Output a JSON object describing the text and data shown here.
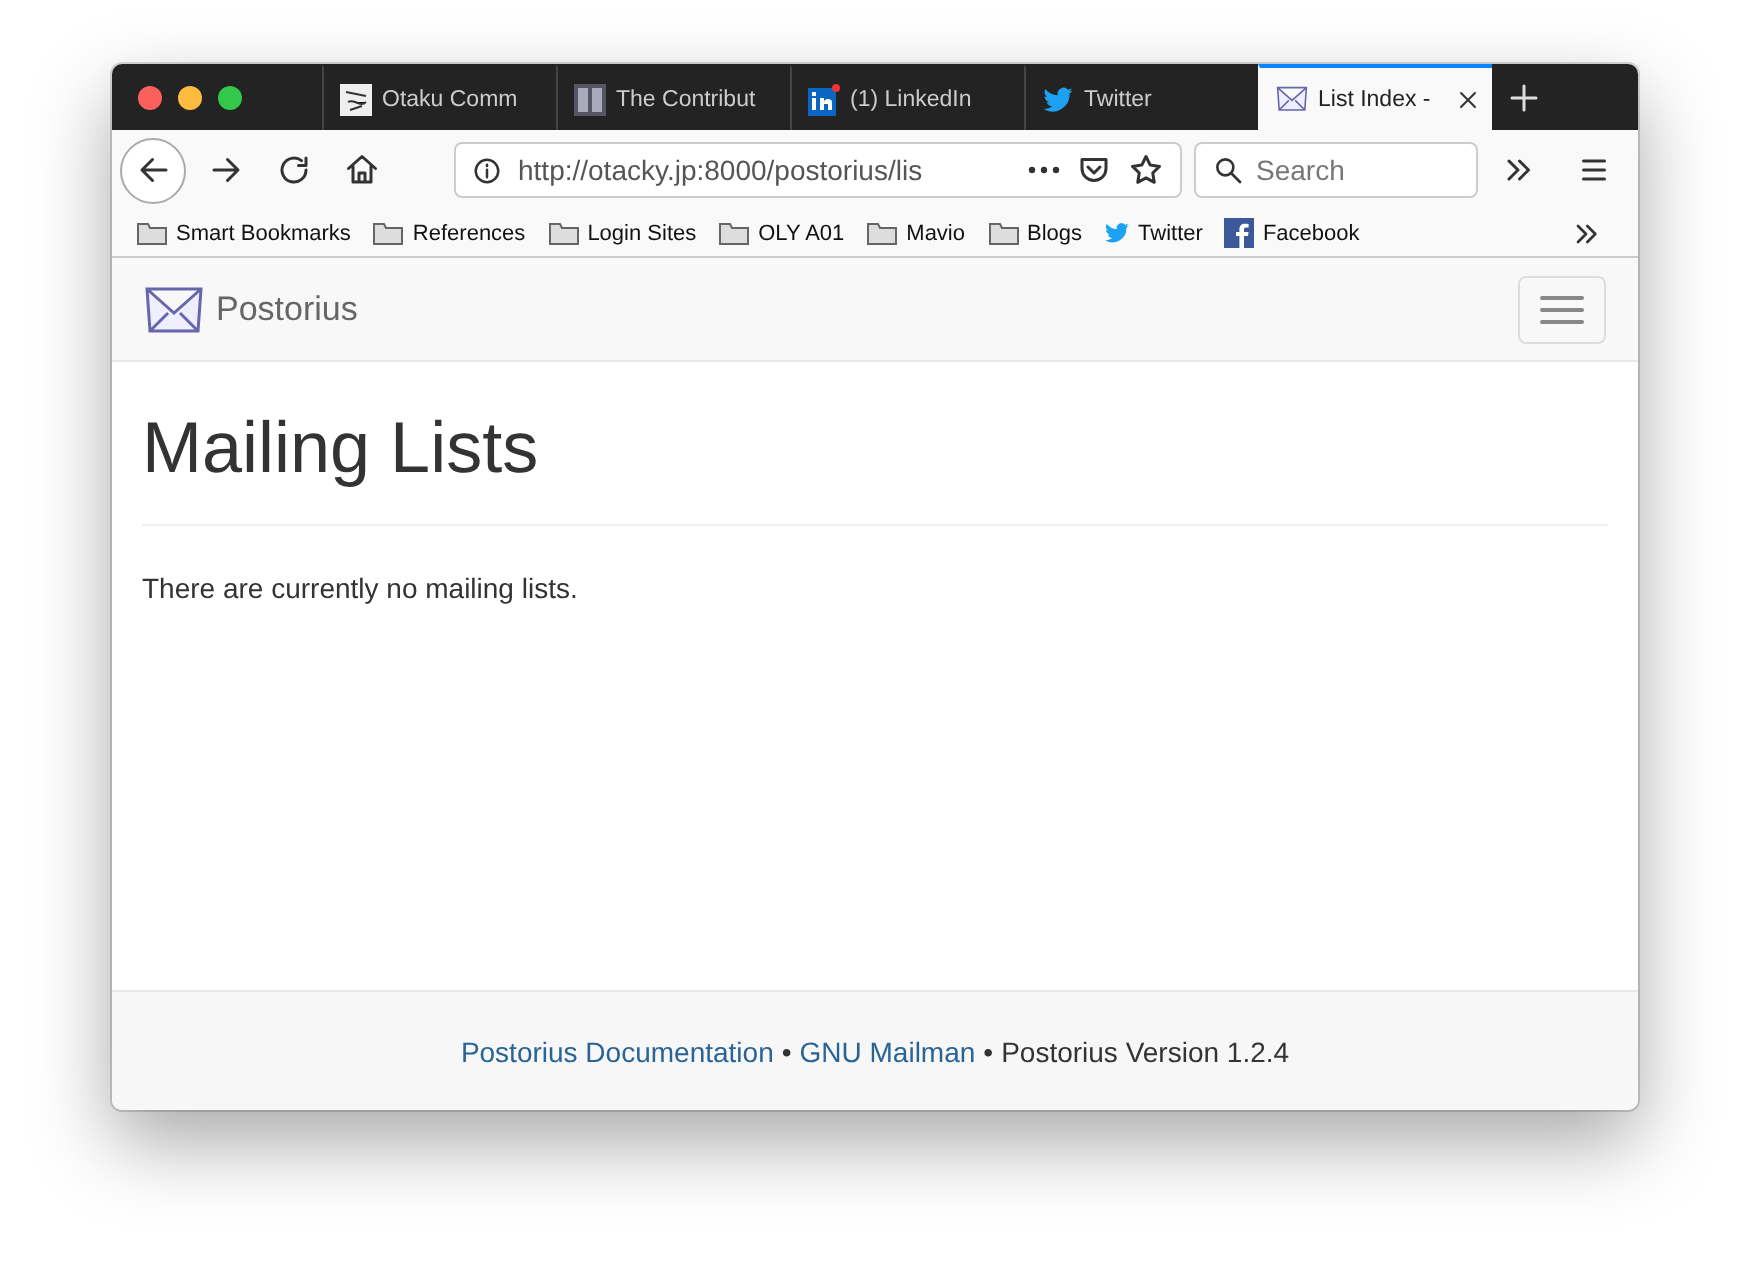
{
  "window": {
    "buttons": [
      {
        "kind": "close"
      },
      {
        "kind": "minimize"
      },
      {
        "kind": "zoom"
      }
    ]
  },
  "tabs": [
    {
      "label": "Otaku Comm",
      "kind": "sketch",
      "selected": false
    },
    {
      "label": "The Contribut",
      "kind": "columns",
      "selected": false
    },
    {
      "label": "(1) LinkedIn",
      "kind": "linkedin",
      "selected": false
    },
    {
      "label": "Twitter",
      "kind": "bird",
      "selected": false
    },
    {
      "label": "List Index -",
      "kind": "envelope",
      "selected": true
    }
  ],
  "address_bar": {
    "url": "http://otacky.jp:8000/postorius/lis"
  },
  "search": {
    "placeholder": "Search"
  },
  "bookmarks": [
    {
      "label": "Smart Bookmarks",
      "kind": "folder"
    },
    {
      "label": "References",
      "kind": "folder"
    },
    {
      "label": "Login Sites",
      "kind": "folder"
    },
    {
      "label": "OLY A01",
      "kind": "folder"
    },
    {
      "label": "Mavio",
      "kind": "folder"
    },
    {
      "label": "Blogs",
      "kind": "folder"
    },
    {
      "label": "Twitter",
      "kind": "bird"
    },
    {
      "label": "Facebook",
      "kind": "facebook"
    }
  ],
  "navbar": {
    "brand": "Postorius"
  },
  "page": {
    "heading": "Mailing Lists",
    "message": "There are currently no mailing lists."
  },
  "footer": [
    {
      "kind": "link",
      "text": "Postorius Documentation"
    },
    {
      "kind": "separator",
      "text": "•"
    },
    {
      "kind": "link",
      "text": "GNU Mailman"
    },
    {
      "kind": "separator",
      "text": "•"
    },
    {
      "kind": "text",
      "text": "Postorius Version 1.2.4"
    }
  ]
}
